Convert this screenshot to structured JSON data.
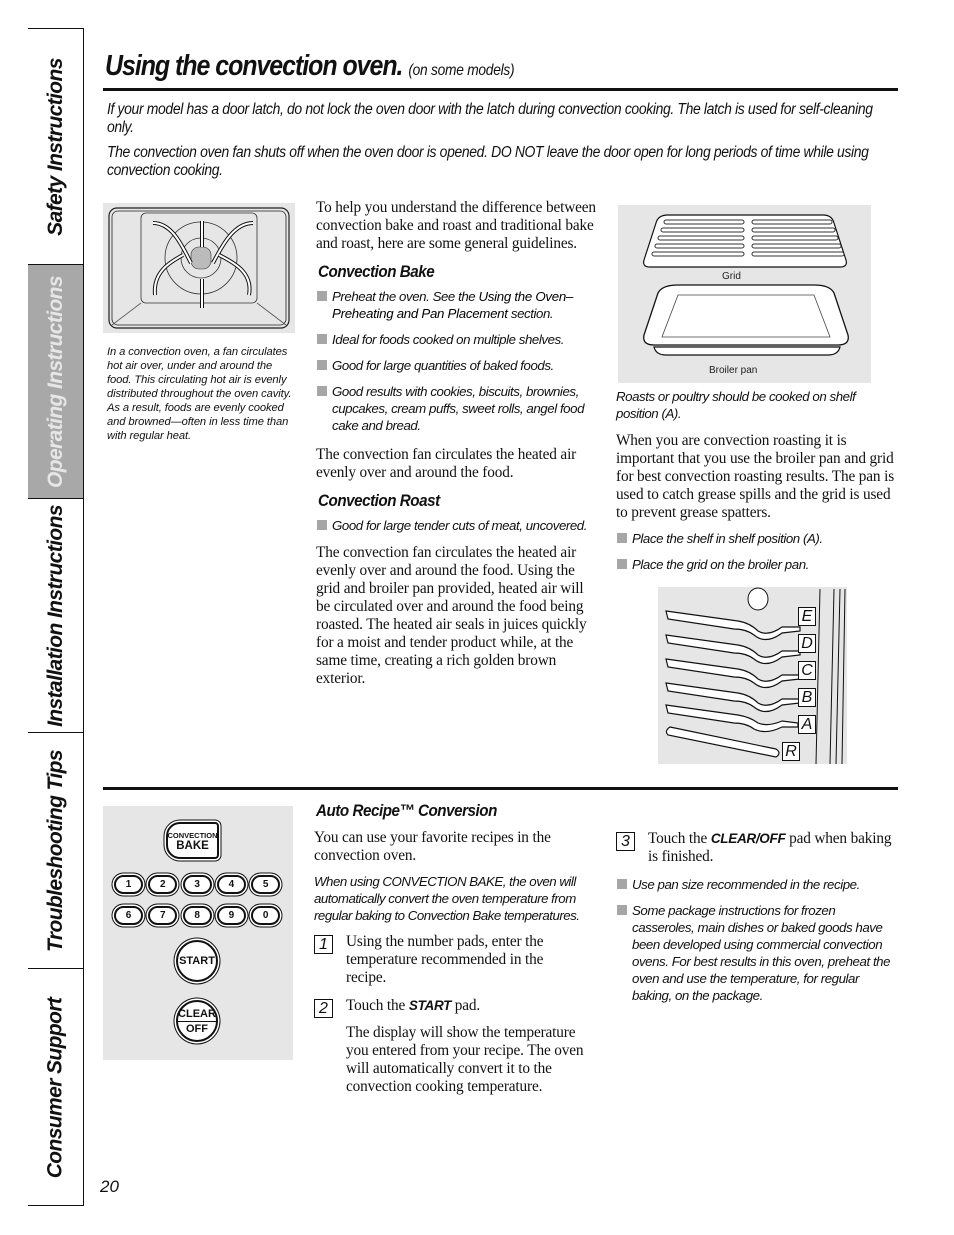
{
  "side_tabs": [
    {
      "label": "Safety Instructions",
      "active": false
    },
    {
      "label": "Operating Instructions",
      "active": true
    },
    {
      "label": "Installation Instructions",
      "active": false
    },
    {
      "label": "Troubleshooting Tips",
      "active": false
    },
    {
      "label": "Consumer Support",
      "active": false
    }
  ],
  "header": {
    "title": "Using the convection oven.",
    "subtitle": "(on some models)"
  },
  "intro": {
    "p1": "If your model has a door latch, do not lock the oven door with the latch during convection cooking. The latch is used for self-cleaning only.",
    "p2": "The convection oven fan shuts off when the oven door is opened. DO NOT leave the door open for long periods of time while using convection cooking."
  },
  "oven_figure": {
    "icon": "convection-airflow-diagram",
    "caption": "In a convection oven, a fan circulates hot air over, under and around the food. This circulating hot air is evenly distributed throughout the oven cavity. As a result, foods are evenly cooked and browned—often in less time than with regular heat."
  },
  "guidelines": {
    "intro": "To help you understand the difference between convection bake and roast and traditional bake and roast, here are some general guidelines.",
    "bake": {
      "heading": "Convection Bake",
      "bullets": [
        {
          "pre": "Preheat the oven. See the ",
          "ref": "Using the Oven–Preheating and Pan Placement",
          "post": " section."
        },
        {
          "pre": "Ideal for foods cooked on multiple shelves.",
          "ref": "",
          "post": ""
        },
        {
          "pre": "Good for large quantities of baked foods.",
          "ref": "",
          "post": ""
        },
        {
          "pre": "Good results with cookies, biscuits, brownies, cupcakes, cream puffs, sweet rolls, angel food cake and bread.",
          "ref": "",
          "post": ""
        }
      ],
      "body": "The convection fan circulates the heated air evenly over and around the food."
    },
    "roast": {
      "heading": "Convection Roast",
      "bullets": [
        "Good for large tender cuts of meat, uncovered."
      ],
      "body": "The convection fan circulates the heated air evenly over and around the food. Using the grid and broiler pan provided, heated air will be circulated over and around the food being roasted. The heated air seals in juices quickly for a moist and tender product while, at the same time, creating a rich golden brown exterior."
    }
  },
  "pans_figure": {
    "grid_label": "Grid",
    "pan_label": "Broiler pan",
    "caption": "Roasts or poultry should be cooked on shelf position (A)."
  },
  "roasting": {
    "body": "When you are convection roasting it is important that you use the broiler pan and grid for best convection roasting results. The pan is used to catch grease spills and the grid is used to prevent grease spatters.",
    "bullets": [
      "Place the shelf in shelf position (A).",
      "Place the grid on the broiler pan."
    ]
  },
  "racks_figure": {
    "positions": [
      "E",
      "D",
      "C",
      "B",
      "A",
      "R"
    ]
  },
  "control_pad": {
    "convection_bake": {
      "line1": "CONVECTION",
      "line2": "BAKE"
    },
    "numbers": [
      "1",
      "2",
      "3",
      "4",
      "5",
      "6",
      "7",
      "8",
      "9",
      "0"
    ],
    "start": "START",
    "clear": {
      "line1": "CLEAR",
      "line2": "OFF"
    }
  },
  "auto_recipe": {
    "heading": "Auto Recipe™ Conversion",
    "intro": "You can use your favorite recipes in the convection oven.",
    "note": "When using CONVECTION BAKE, the oven will automatically convert the oven temperature from regular baking to Convection Bake temperatures.",
    "steps": [
      {
        "num": "1",
        "pre": "Using the number pads, enter the temperature recommended in the recipe.",
        "kw": "",
        "post": ""
      },
      {
        "num": "2",
        "pre": "Touch the ",
        "kw": "START",
        "post": " pad."
      },
      {
        "num": "3",
        "pre": "Touch the ",
        "kw": "CLEAR/OFF",
        "post": " pad when baking is finished."
      }
    ],
    "step2_detail": "The display will show the temperature you entered from your recipe. The oven will automatically convert it to the convection cooking temperature.",
    "bullets": [
      "Use pan size recommended in the recipe.",
      "Some package instructions for frozen casseroles, main dishes or baked goods have been developed using commercial convection ovens. For best results in this oven, preheat the oven and use the temperature, for regular baking, on the package."
    ]
  },
  "page_number": "20"
}
